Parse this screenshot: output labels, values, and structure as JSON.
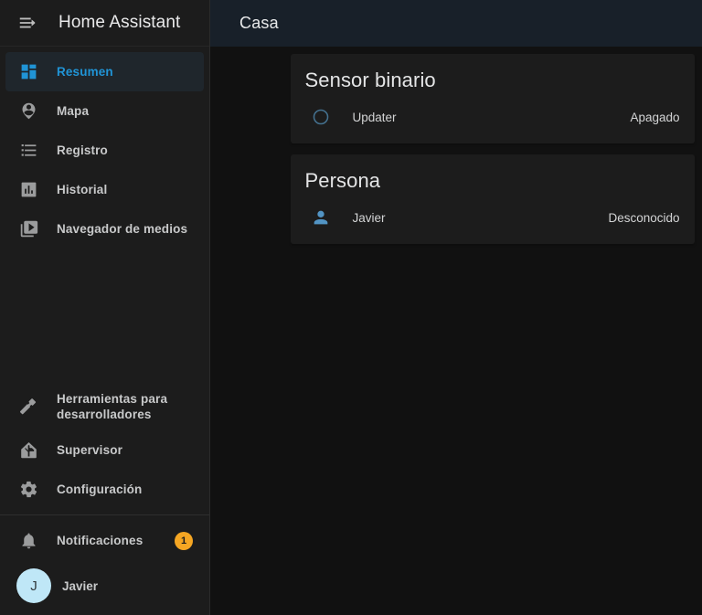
{
  "sidebar": {
    "menu_icon": "menu-open-icon",
    "title": "Home Assistant",
    "items": [
      {
        "label": "Resumen",
        "icon": "view-dashboard-icon",
        "active": true
      },
      {
        "label": "Mapa",
        "icon": "map-marker-account-icon",
        "active": false
      },
      {
        "label": "Registro",
        "icon": "format-list-bulleted-icon",
        "active": false
      },
      {
        "label": "Historial",
        "icon": "chart-box-icon",
        "active": false
      },
      {
        "label": "Navegador de medios",
        "icon": "play-box-multiple-icon",
        "active": false
      }
    ],
    "lower_items": [
      {
        "label": "Herramientas para desarrolladores",
        "icon": "hammer-icon"
      },
      {
        "label": "Supervisor",
        "icon": "home-assistant-logo-icon"
      },
      {
        "label": "Configuración",
        "icon": "gear-icon"
      }
    ],
    "notifications": {
      "label": "Notificaciones",
      "icon": "bell-icon",
      "count": "1"
    },
    "user": {
      "label": "Javier",
      "avatar_initial": "J"
    }
  },
  "topbar": {
    "title": "Casa"
  },
  "cards": [
    {
      "title": "Sensor binario",
      "rows": [
        {
          "name": "Updater",
          "state": "Apagado",
          "icon": "circle-outline-icon"
        }
      ]
    },
    {
      "title": "Persona",
      "rows": [
        {
          "name": "Javier",
          "state": "Desconocido",
          "icon": "account-icon"
        }
      ]
    }
  ],
  "colors": {
    "accent": "#2094d6",
    "sidebar_bg": "#1c1c1c",
    "main_bg": "#111111",
    "topbar_bg": "#182029",
    "badge": "#f5a623",
    "avatar": "#bfe7f7",
    "person_icon": "#5294c4",
    "circle_icon": "#3f6d8c"
  }
}
